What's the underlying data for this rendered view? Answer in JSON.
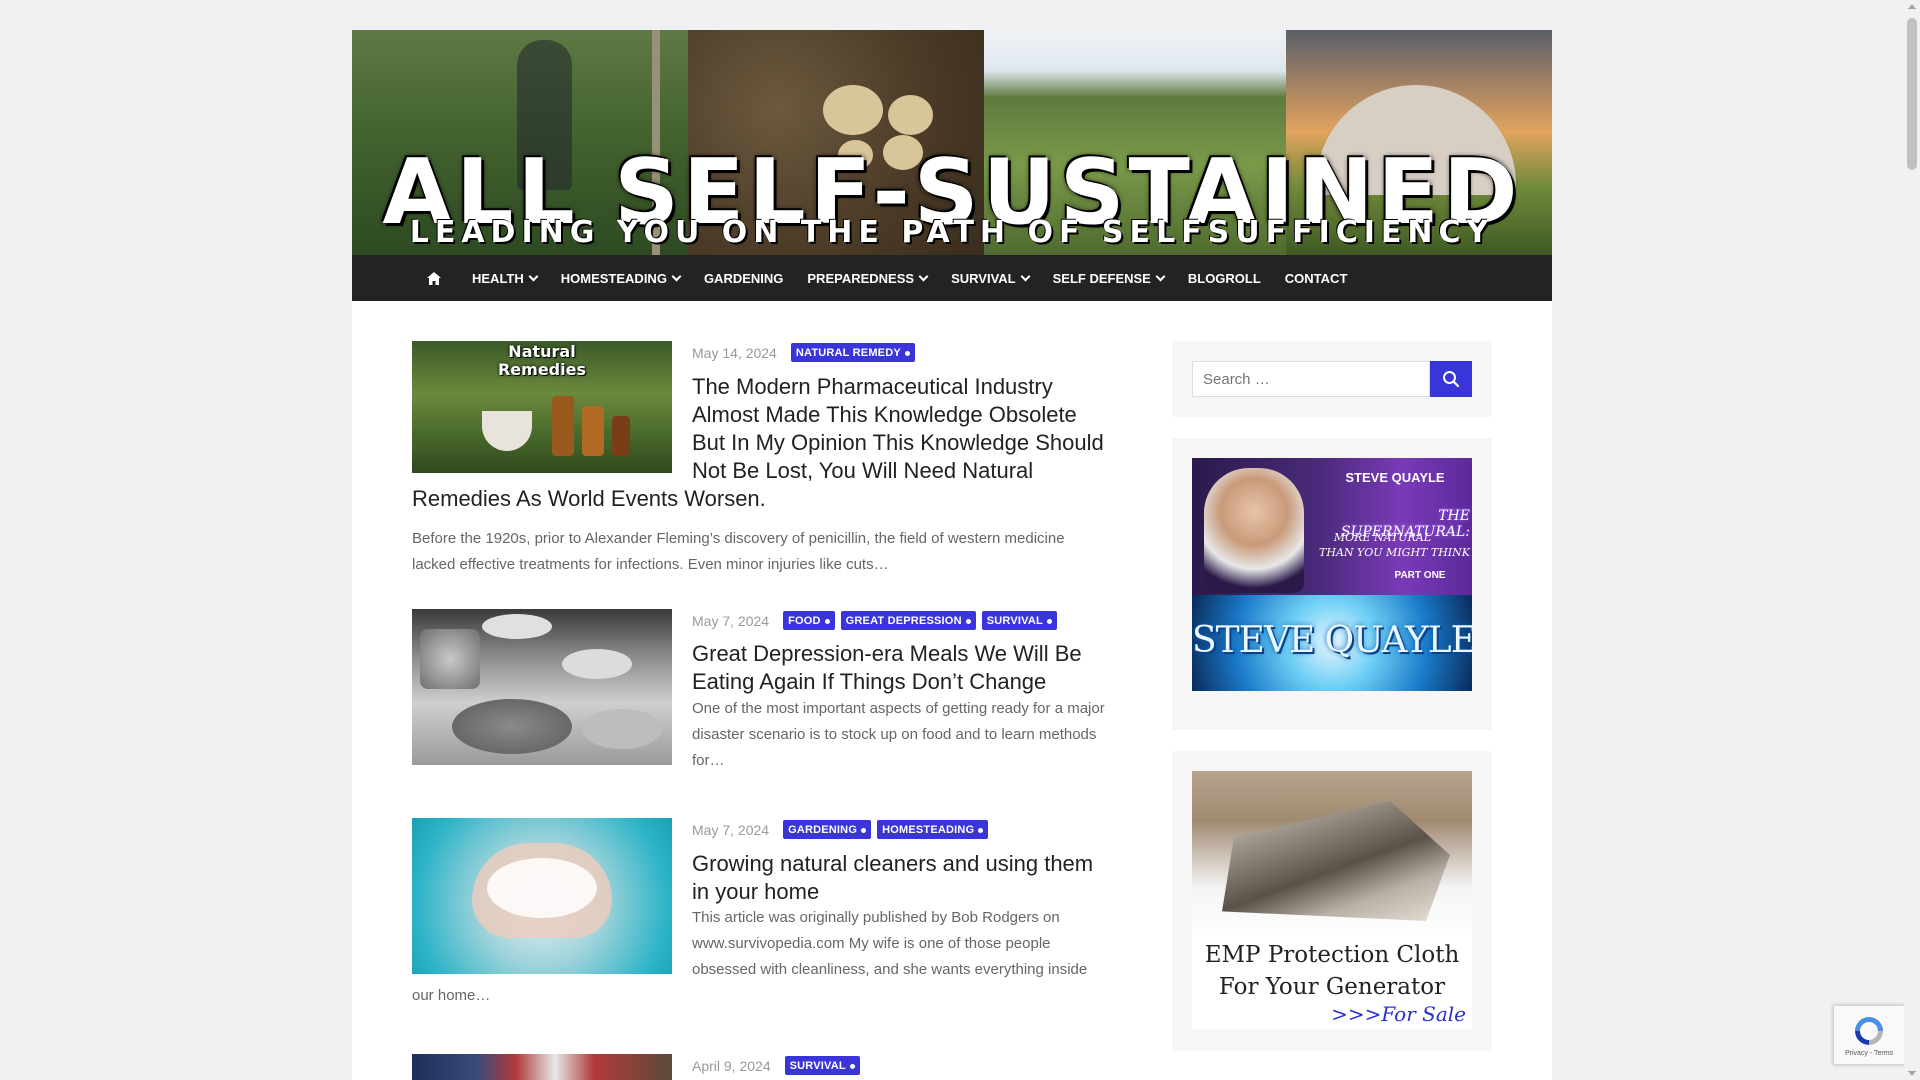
{
  "site": {
    "title": "ALL SELF-SUSTAINED",
    "tagline": "LEADING YOU ON THE PATH OF SELFSUFFICIENCY"
  },
  "nav": {
    "items": [
      {
        "label": "HEALTH",
        "dropdown": true
      },
      {
        "label": "HOMESTEADING",
        "dropdown": true
      },
      {
        "label": "GARDENING",
        "dropdown": false
      },
      {
        "label": "PREPAREDNESS",
        "dropdown": true
      },
      {
        "label": "SURVIVAL",
        "dropdown": true
      },
      {
        "label": "SELF DEFENSE",
        "dropdown": true
      },
      {
        "label": "BLOGROLL",
        "dropdown": false
      },
      {
        "label": "CONTACT",
        "dropdown": false
      }
    ]
  },
  "posts": [
    {
      "date": "May 14, 2024",
      "categories": [
        "NATURAL REMEDY"
      ],
      "title_wrap": "The Modern Pharmaceutical Industry Almost Made This Knowledge Obsolete But In My Opinion This Knowledge Should Not Be Lost, You Will Need Natural",
      "title_tail": "Remedies As World Events Worsen.",
      "excerpt": "Before the 1920s, prior to Alexander Fleming’s discovery of penicillin, the field of western medicine lacked effective treatments for infections. Even minor injuries like cuts…",
      "thumb_caption": "Natural Remedies"
    },
    {
      "date": "May 7, 2024",
      "categories": [
        "FOOD",
        "GREAT DEPRESSION",
        "SURVIVAL"
      ],
      "title_wrap": "Great Depression-era Meals We Will Be Eating Again If Things Don’t Change",
      "excerpt": "One of the most important aspects of getting ready for a major disaster scenario is to stock up on food and to learn methods for…"
    },
    {
      "date": "May 7, 2024",
      "categories": [
        "GARDENING",
        "HOMESTEADING"
      ],
      "title_wrap": "Growing natural cleaners and using them in your home",
      "excerpt_wrap": "This article was originally published by Bob Rodgers on www.survivopedia.com My wife is one of those people obsessed with cleanliness, and she wants everything inside",
      "excerpt_tail": "our home…"
    },
    {
      "date": "April 9, 2024",
      "categories": [
        "SURVIVAL"
      ]
    }
  ],
  "sidebar": {
    "search_placeholder": "Search …",
    "ad1": {
      "name": "STEVE QUAYLE",
      "headline": "THE SUPERNATURAL:",
      "sub1": "MORE NATURAL",
      "sub2": "THAN YOU MIGHT THINK",
      "part": "PART ONE",
      "site": "STEVE QUAYLE.com"
    },
    "ad2": {
      "line1": "EMP Protection Cloth",
      "line2": "For Your Generator",
      "line3": ">>>For Sale"
    }
  },
  "recaptcha": {
    "text": "Privacy - Terms"
  },
  "colors": {
    "accent": "#3a35d9",
    "nav_bg": "#232323",
    "page_bg": "#f1f1f1"
  }
}
